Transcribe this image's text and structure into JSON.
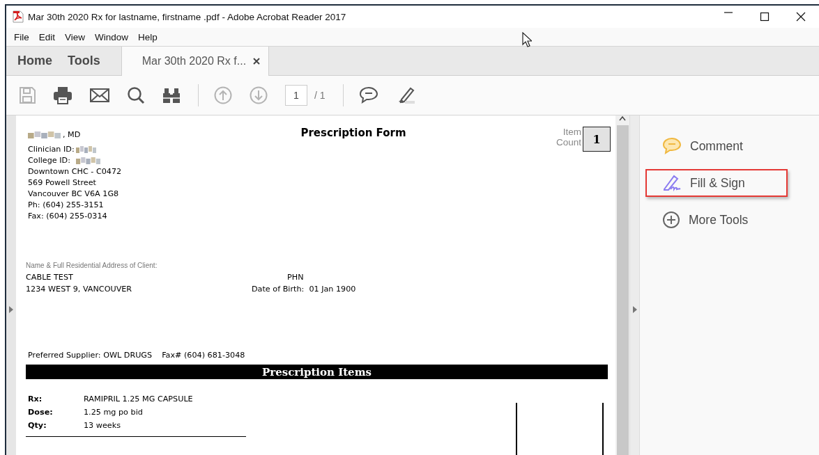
{
  "window": {
    "title": "Mar 30th 2020 Rx for lastname, firstname .pdf - Adobe Acrobat Reader 2017"
  },
  "menu": [
    "File",
    "Edit",
    "View",
    "Window",
    "Help"
  ],
  "tabs": [
    {
      "label": "Home",
      "kind": "nav",
      "selected": false
    },
    {
      "label": "Tools",
      "kind": "nav",
      "selected": false
    },
    {
      "label": "Mar 30th 2020 Rx f...",
      "kind": "document",
      "selected": true
    }
  ],
  "toolbar": {
    "tools": [
      {
        "kind": "save",
        "disabled": true
      },
      {
        "kind": "print",
        "disabled": false
      },
      {
        "kind": "email",
        "disabled": false
      },
      {
        "kind": "search",
        "disabled": false
      },
      {
        "kind": "find",
        "disabled": false
      },
      {
        "kind": "sep"
      },
      {
        "kind": "prev",
        "disabled": true
      },
      {
        "kind": "next",
        "disabled": true
      }
    ],
    "page": "1",
    "page_total": "/ 1",
    "annotate": [
      {
        "kind": "comment",
        "disabled": false
      },
      {
        "kind": "highlight",
        "disabled": false
      }
    ]
  },
  "document": {
    "title": "Prescription Form",
    "item_count_label": "Item Count",
    "item_count": "1",
    "prescriber": {
      "name_suffix": ", MD",
      "clinician_id_label": "Clinician ID:",
      "college_id_label": "College ID:",
      "address_lines": [
        "Downtown CHC - C0472",
        "569 Powell Street",
        "Vancouver BC V6A 1G8",
        "Ph: (604) 255-3151",
        "Fax: (604) 255-0314"
      ]
    },
    "client": {
      "label": "Name & Full Residential Address of Client:",
      "name": "CABLE TEST",
      "address": "1234 WEST 9, VANCOUVER",
      "phn_label": "PHN",
      "dob_label": "Date of Birth:",
      "dob": "01 Jan 1900"
    },
    "supplier": "Preferred Supplier: OWL DRUGS",
    "supplier_fax": "Fax# (604) 681-3048",
    "items_header": "Prescription Items",
    "rx": [
      {
        "label": "Rx:",
        "value": "RAMIPRIL 1.25 MG CAPSULE"
      },
      {
        "label": "Dose:",
        "value": "1.25 mg po bid"
      },
      {
        "label": "Qty:",
        "value": "13 weeks"
      }
    ]
  },
  "tools_panel": [
    {
      "kind": "comment",
      "label": "Comment",
      "highlighted": false
    },
    {
      "kind": "fill-sign",
      "label": "Fill & Sign",
      "highlighted": true
    },
    {
      "kind": "more",
      "label": "More Tools",
      "highlighted": false
    }
  ]
}
